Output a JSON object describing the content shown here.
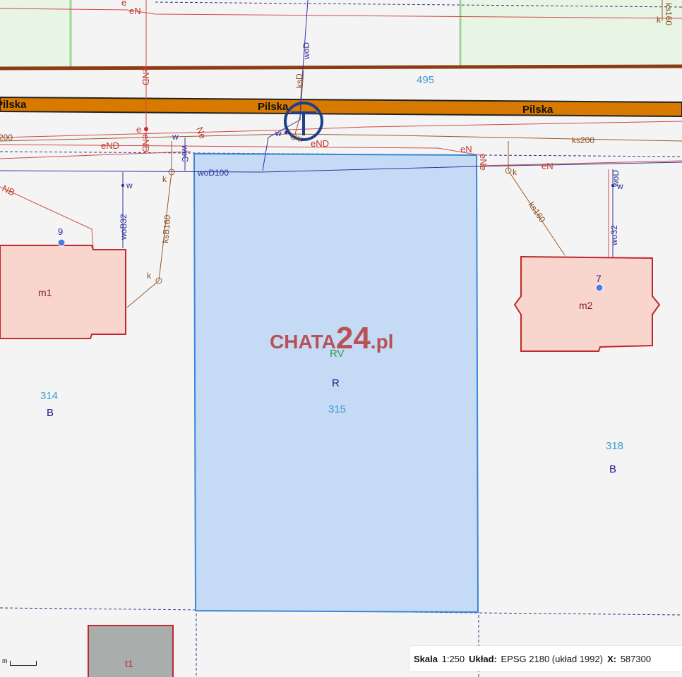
{
  "watermark": {
    "brand": "CHATA",
    "number": "24",
    "suffix": ".pl"
  },
  "street": {
    "name": "Pilska"
  },
  "parcels": {
    "top": "495",
    "left": {
      "number": "314",
      "use": "B"
    },
    "center": {
      "number": "315",
      "use_code": "RV",
      "use": "R"
    },
    "right": {
      "number": "318",
      "use": "B"
    }
  },
  "buildings": {
    "left": {
      "label": "m1",
      "address": "9"
    },
    "right": {
      "label": "m2",
      "address": "7"
    },
    "bottom": {
      "label": "t1"
    }
  },
  "utility_labels": {
    "woD": "woD",
    "ksD": "ksD",
    "eND": "eND",
    "eN": "eN",
    "e": "e",
    "woD100": "woD100",
    "ks200": "ks200",
    "woB32": "woB32",
    "ksB160": "ksB160",
    "ks160": "ks160",
    "wo32": "wo32",
    "w": "w",
    "k": "k",
    "ks160_top": "ks160",
    "NB": "NB",
    "Ne": "Ne",
    "woC": "woC",
    "eNe": "eNe",
    "ks200_left": "200"
  },
  "scale_info": {
    "scale_label": "Skala",
    "scale_value": "1:250",
    "system_label": "Układ:",
    "system_value": "EPSG 2180 (układ 1992)",
    "x_label": "X:",
    "x_value": "587300"
  },
  "mini_scale": {
    "unit": "m"
  },
  "colors": {
    "road": "#d97a00",
    "parcel_fill": "#c5daf4",
    "parcel_border": "#3b86d6",
    "building_fill": "#f8d6ce",
    "building_border": "#c0282c",
    "green_area": "#e8f4e4",
    "watermark": "#b43a3a"
  }
}
